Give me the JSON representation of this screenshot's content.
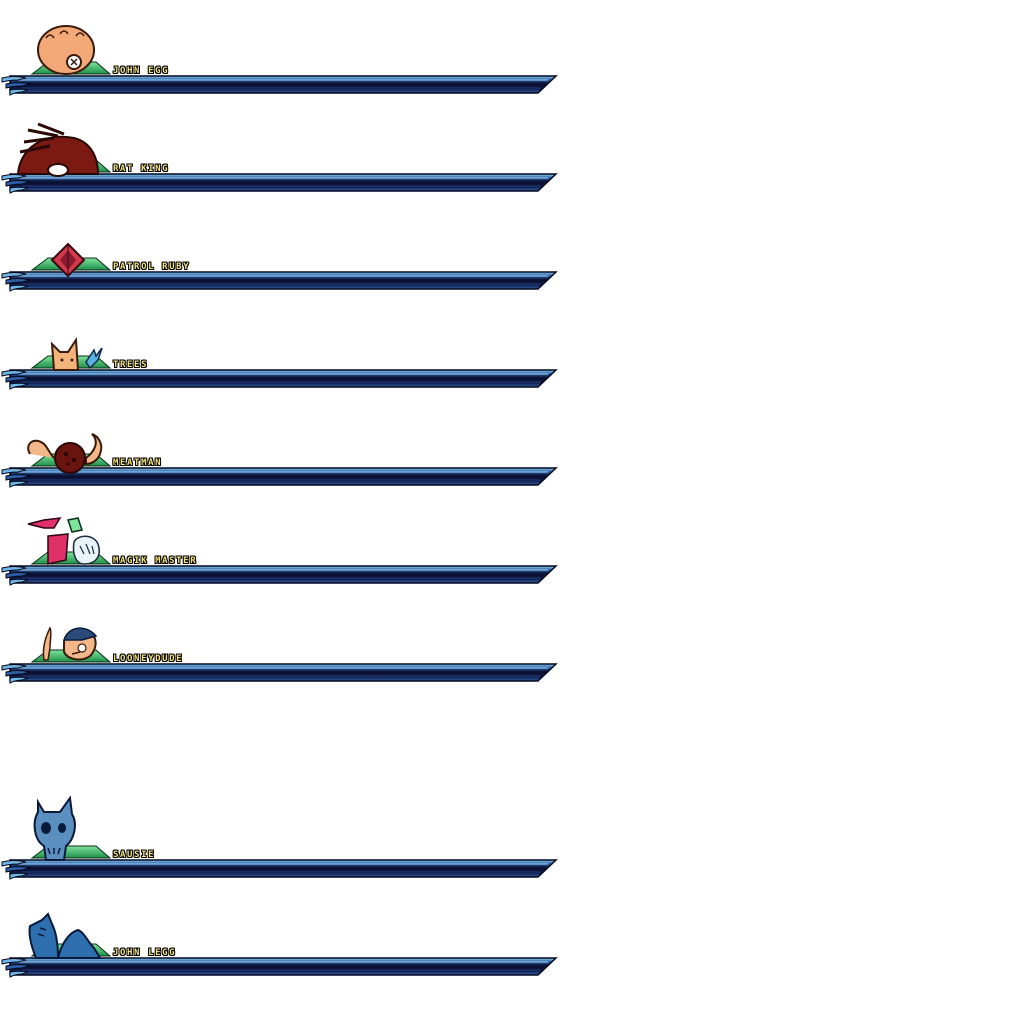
{
  "characters": [
    {
      "name": "JOHN EGG",
      "icon": "egg-head-icon"
    },
    {
      "name": "RAT KING",
      "icon": "rat-king-icon"
    },
    {
      "name": "PATROL RUBY",
      "icon": "ruby-gem-icon"
    },
    {
      "name": "TREES",
      "icon": "fox-and-bird-icon"
    },
    {
      "name": "MEATMAN",
      "icon": "meatball-icon"
    },
    {
      "name": "MAGIK MASTER",
      "icon": "magik-master-icon"
    },
    {
      "name": "LOONEYDUDE",
      "icon": "looneydude-icon"
    },
    {
      "name": "SAUSIE",
      "icon": "skull-icon"
    },
    {
      "name": "JOHN LEGG",
      "icon": "john-legg-icon"
    }
  ],
  "colors": {
    "label_text": "#f5e27a",
    "bar_dark": "#0a0f2e",
    "bar_mid": "#1f3d78",
    "bar_light": "#6fb6e6",
    "green_tab": "#3fbf6a"
  }
}
